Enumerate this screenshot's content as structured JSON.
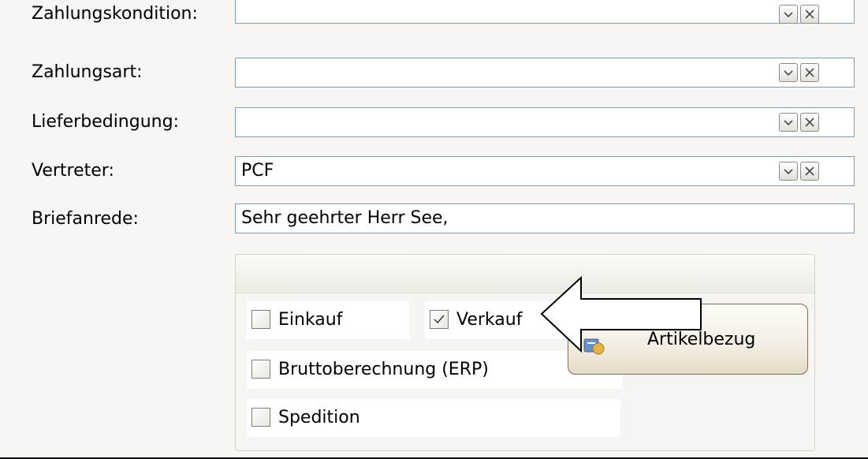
{
  "form": {
    "rows": [
      {
        "label": "Zahlungskondition:",
        "value": "",
        "has_buttons": true
      },
      {
        "label": "Zahlungsart:",
        "value": "",
        "has_buttons": true
      },
      {
        "label": "Lieferbedingung:",
        "value": "",
        "has_buttons": true
      },
      {
        "label": "Vertreter:",
        "value": "PCF",
        "has_buttons": true
      },
      {
        "label": "Briefanrede:",
        "value": "Sehr geehrter Herr See,",
        "has_buttons": false
      }
    ]
  },
  "group": {
    "checkboxes": [
      {
        "label": "Einkauf",
        "checked": false
      },
      {
        "label": "Verkauf",
        "checked": true
      },
      {
        "label": "Bruttoberechnung (ERP)",
        "checked": false
      },
      {
        "label": "Spedition",
        "checked": false
      }
    ],
    "button_label": "Artikelbezug",
    "button_icon": "article-relation-icon"
  },
  "icons": {
    "dropdown": "chevron-down-icon",
    "clear": "close-icon",
    "annotation": "left-arrow-annotation"
  },
  "colors": {
    "field_border": "#7f9db9",
    "panel_bg": "#f7f6f3",
    "button_border": "#7a6c58"
  }
}
